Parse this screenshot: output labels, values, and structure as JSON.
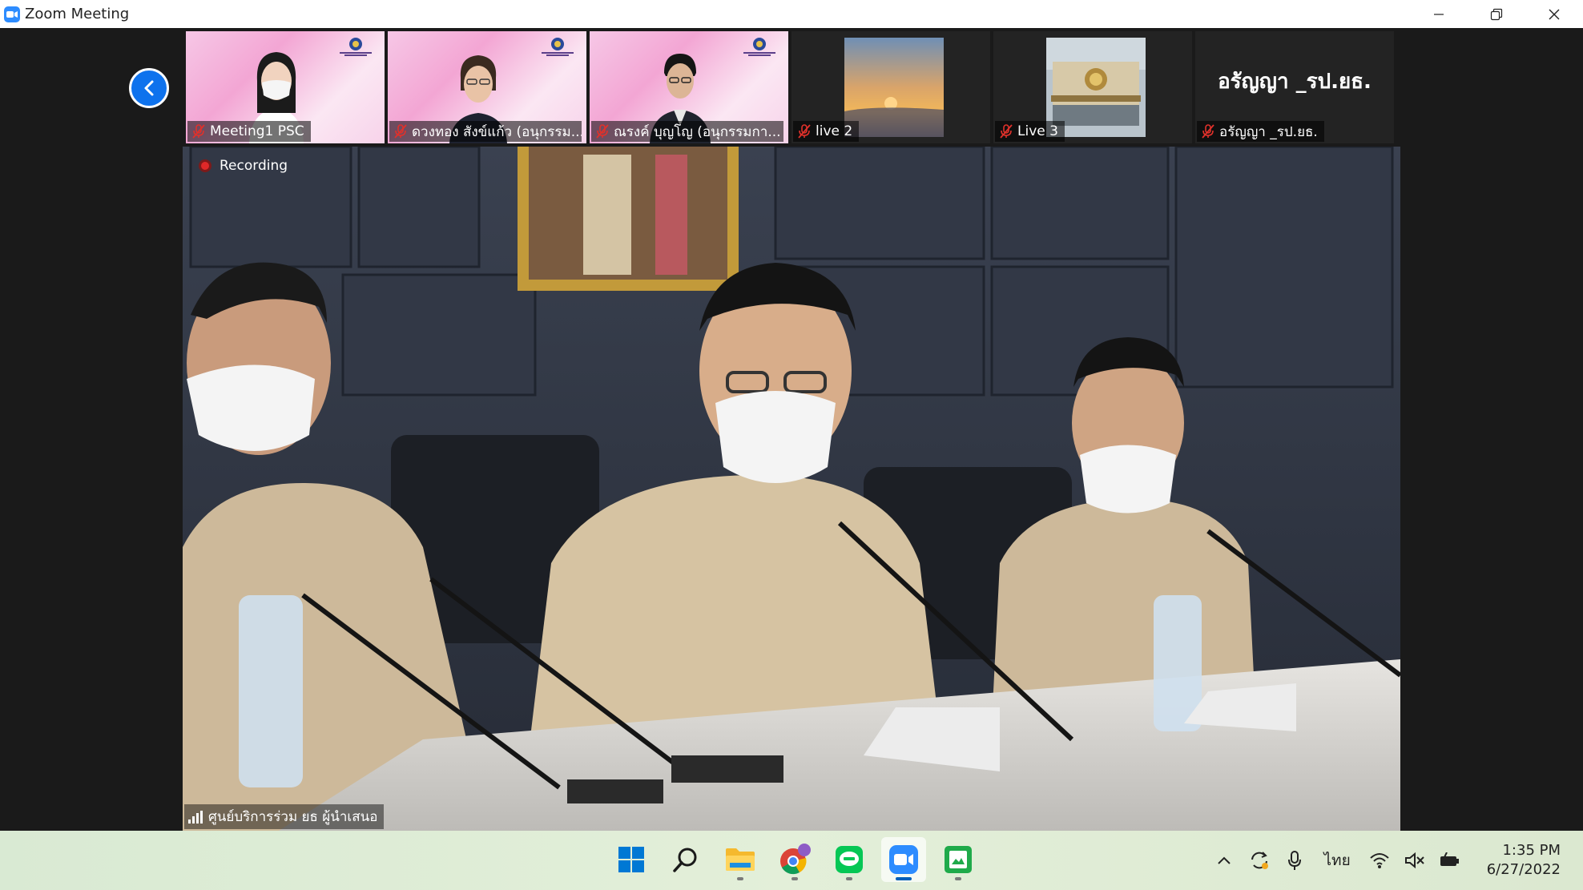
{
  "window": {
    "title": "Zoom Meeting"
  },
  "participants": [
    {
      "name": "Meeting1 PSC",
      "muted": true
    },
    {
      "name": "ดวงทอง สังข์แก้ว (อนุกรรม...",
      "muted": true
    },
    {
      "name": "ณรงค์ บุญโญ (อนุกรรมกา...",
      "muted": true
    },
    {
      "name": "live 2",
      "muted": true
    },
    {
      "name": "Live 3",
      "muted": true
    },
    {
      "name": "อรัญญา _รป.ยธ.",
      "muted": true,
      "display_name": "อรัญญา _รป.ยธ."
    }
  ],
  "main_video": {
    "recording_label": "Recording",
    "speaker_name": "ศูนย์บริการร่วม ยธ ผู้นำเสนอ"
  },
  "taskbar": {
    "apps": [
      "windows-start",
      "search",
      "file-explorer",
      "chrome",
      "line",
      "zoom",
      "greenshot"
    ],
    "active_app": "zoom",
    "language": "ไทย",
    "time": "1:35 PM",
    "date": "6/27/2022"
  },
  "colors": {
    "zoom_blue": "#0e72ed",
    "mute_red": "#e0312b",
    "recording_red": "#e02828"
  }
}
